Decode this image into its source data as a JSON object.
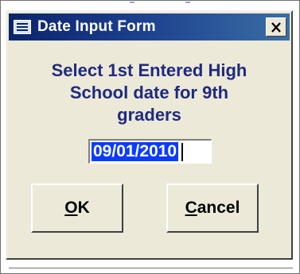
{
  "window": {
    "title": "Date Input Form",
    "close_glyph": "×"
  },
  "prompt": {
    "line1": "Select 1st Entered High",
    "line2": "School date for 9th",
    "line3": "graders"
  },
  "date_field": {
    "value": "09/01/2010"
  },
  "buttons": {
    "ok": {
      "mnemonic": "O",
      "rest": "K"
    },
    "cancel": {
      "mnemonic": "C",
      "rest": "ancel"
    }
  },
  "colors": {
    "titlebar_start": "#0a246a",
    "titlebar_end": "#3a6ea5",
    "prompt_text": "#1f2a80",
    "selection": "#0a3cff",
    "face": "#ece9d8"
  },
  "icons": {
    "title": "form-icon",
    "close": "close-icon"
  }
}
